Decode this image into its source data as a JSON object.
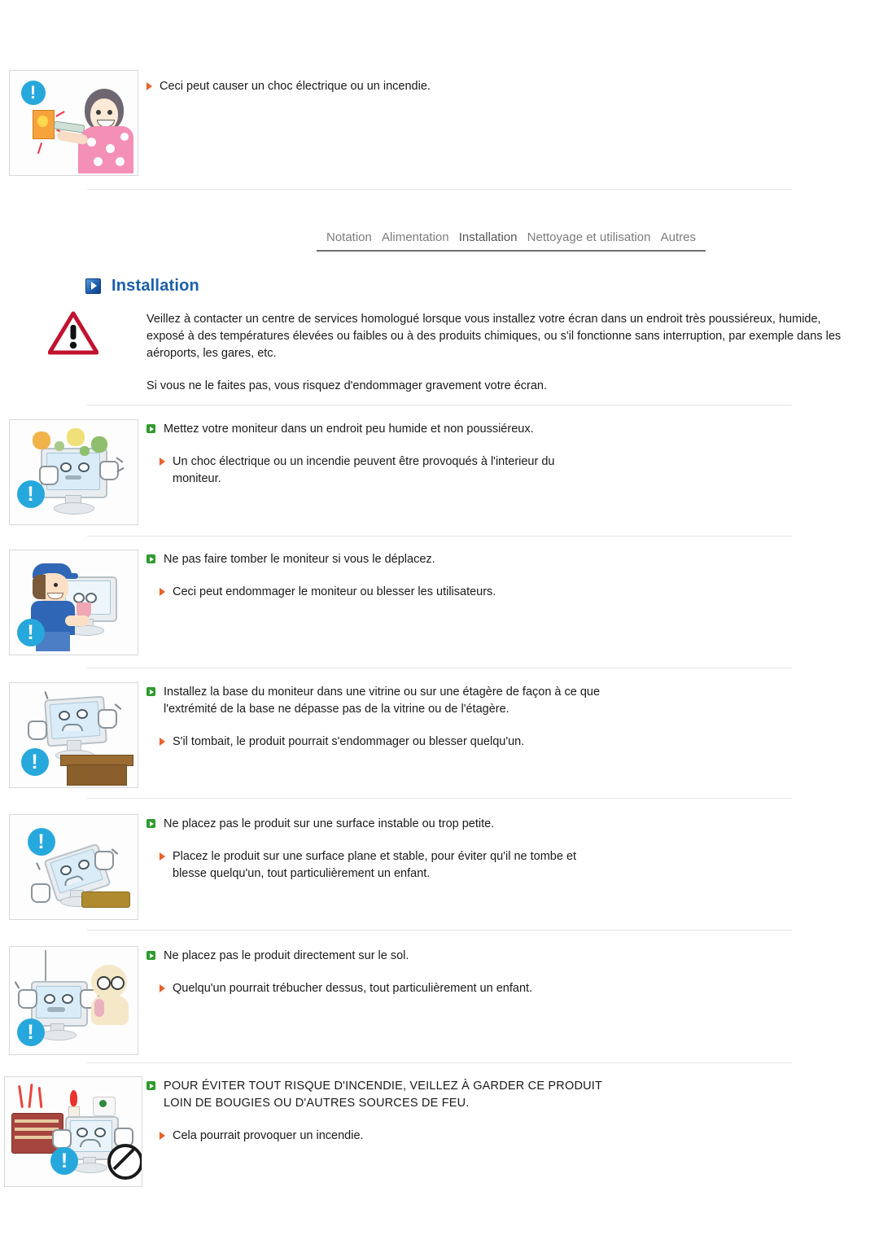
{
  "document": {
    "language": "fr",
    "top_note": {
      "text": "Ceci peut causer un choc électrique ou un incendie.",
      "bullet_icon": "triangle-right-orange-icon",
      "illustration": "woman-plugging-cord-sparking-outlet-illustration"
    },
    "tabs": [
      {
        "label": "Notation",
        "active": false
      },
      {
        "label": "Alimentation",
        "active": false
      },
      {
        "label": "Installation",
        "active": true
      },
      {
        "label": "Nettoyage et utilisation",
        "active": false
      },
      {
        "label": "Autres",
        "active": false
      }
    ],
    "section": {
      "icon": "play-square-blue-icon",
      "title": "Installation",
      "title_color": "#1b5faa"
    },
    "intro": {
      "icon": "warning-triangle-icon",
      "icon_color": "#c1122f",
      "paragraphs": [
        "Veillez à contacter un centre de services homologué lorsque vous installez votre écran dans un endroit très poussiéreux, humide, exposé à des températures élevées ou faibles ou à des produits chimiques, ou s'il fonctionne sans interruption, par exemple dans les aéroports, les gares, etc.",
        "Si vous ne le faites pas, vous risquez d'endommager gravement votre écran."
      ]
    },
    "items": [
      {
        "illustration": "monitor-with-dust-and-germs-illustration",
        "badge": "exclamation-circle-blue-icon",
        "main": "Mettez votre moniteur dans un endroit peu humide et non poussiéreux.",
        "sub": "Un choc électrique ou un incendie peuvent être provoqués à l'interieur du moniteur.",
        "caps": false
      },
      {
        "illustration": "man-carrying-monitor-illustration",
        "badge": "exclamation-circle-blue-icon",
        "main": "Ne pas faire tomber le moniteur si vous le déplacez.",
        "sub": "Ceci peut endommager le moniteur ou blesser les utilisateurs.",
        "caps": false
      },
      {
        "illustration": "monitor-falling-off-shelf-illustration",
        "badge": "exclamation-circle-blue-icon",
        "main": "Installez la base du moniteur dans une vitrine ou sur une étagère de façon à ce que l'extrémité de la base ne dépasse pas de la vitrine ou de l'étagère.",
        "sub": "S'il tombait, le produit pourrait s'endommager ou blesser quelqu'un.",
        "caps": false
      },
      {
        "illustration": "monitor-tipping-on-unstable-surface-illustration",
        "badge": "exclamation-circle-blue-icon",
        "main": "Ne placez pas le produit sur une surface instable ou trop petite.",
        "sub": "Placez le produit sur une surface plane et stable, pour éviter qu'il ne tombe et blesse quelqu'un, tout particulièrement un enfant.",
        "caps": false
      },
      {
        "illustration": "monitor-on-floor-with-child-illustration",
        "badge": "exclamation-circle-blue-icon",
        "main": "Ne placez pas le produit directement sur le sol.",
        "sub": "Quelqu'un pourrait trébucher dessus, tout particulièrement un enfant.",
        "caps": false
      },
      {
        "illustration": "monitor-near-heater-and-candle-illustration",
        "badge": "exclamation-circle-blue-icon",
        "main": "POUR ÉVITER TOUT RISQUE D'INCENDIE, VEILLEZ À GARDER CE PRODUIT LOIN DE BOUGIES OU D'AUTRES SOURCES DE FEU.",
        "sub": "Cela pourrait provoquer un incendie.",
        "caps": true
      }
    ]
  }
}
